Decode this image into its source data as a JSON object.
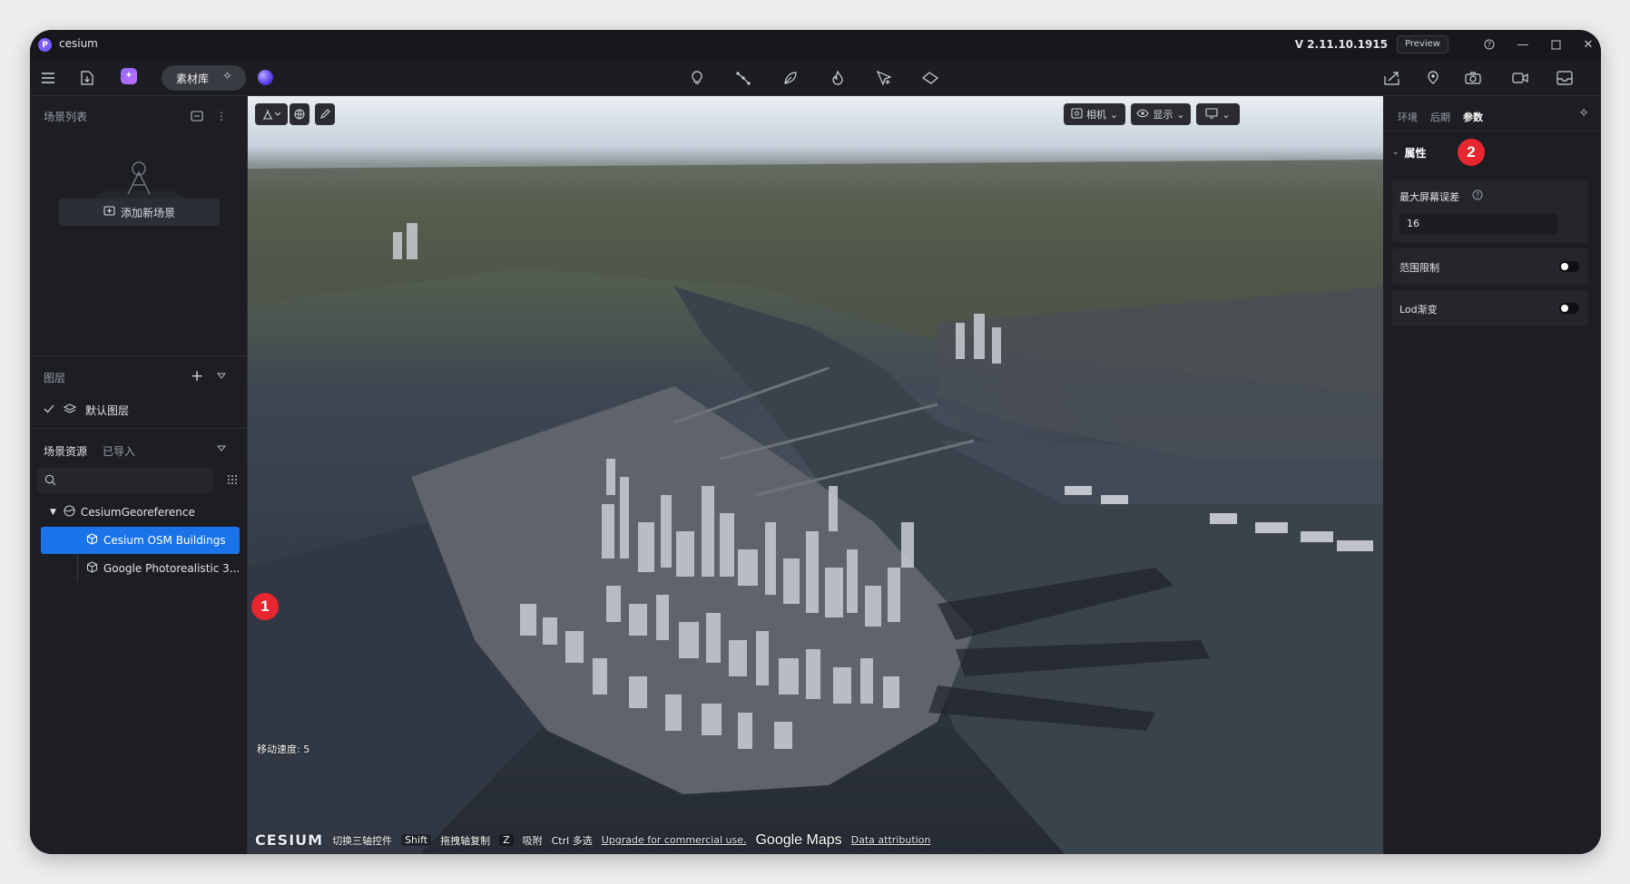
{
  "app": {
    "name": "cesium",
    "version": "V 2.11.10.1915",
    "preview_label": "Preview"
  },
  "toolbar": {
    "library_label": "素材库"
  },
  "sidebar": {
    "scene_list_title": "场景列表",
    "add_scene_label": "添加新场景",
    "layers_title": "图层",
    "default_layer_label": "默认图层",
    "assets_title": "场景资源",
    "imported_tab": "已导入",
    "search_placeholder": "",
    "tree": [
      {
        "label": "CesiumGeoreference",
        "level": 0,
        "expanded": true
      },
      {
        "label": "Cesium OSM Buildings",
        "level": 1,
        "selected": true
      },
      {
        "label": "Google Photorealistic 3...",
        "level": 1
      }
    ]
  },
  "viewport": {
    "camera_label": "相机",
    "display_label": "显示",
    "speed_text": "移动速度: 5",
    "cesium_logo": "CESIUM",
    "hint_switch_axis": "切换三轴控件",
    "hint_shift_key": "Shift",
    "hint_drag_copy": "拖拽轴复制",
    "hint_z_key": "Z",
    "hint_snap": "吸附",
    "hint_ctrl": "Ctrl 多选",
    "upgrade_text": "Upgrade for commercial use.",
    "google_logo": "Google Maps",
    "attribution_text": "Data attribution",
    "badge_1": "1"
  },
  "right_panel": {
    "tabs": [
      "环境",
      "后期",
      "参数"
    ],
    "active_tab": "参数",
    "section_title": "属性",
    "badge_2": "2",
    "max_screen_error_label": "最大屏幕误差",
    "max_screen_error_value": "16",
    "range_limit_label": "范围限制",
    "range_limit_on": false,
    "lod_fade_label": "Lod渐变",
    "lod_fade_on": false
  },
  "colors": {
    "accent": "#1a73e8",
    "badge": "#e8262f",
    "background": "#1f2127"
  }
}
